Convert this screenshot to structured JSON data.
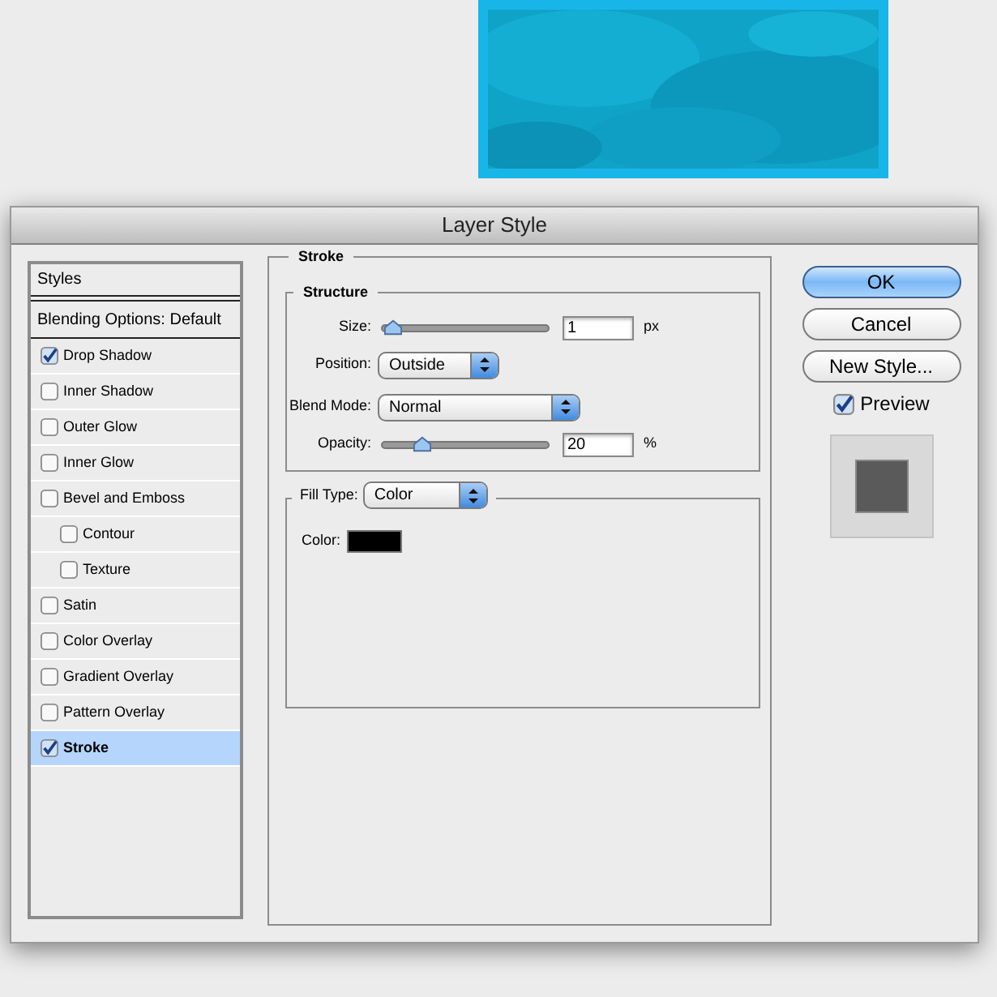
{
  "window": {
    "title": "Layer Style"
  },
  "styles_list": {
    "header": "Styles",
    "blending_options": "Blending Options: Default",
    "items": [
      {
        "label": "Drop Shadow",
        "checked": true,
        "selected": false
      },
      {
        "label": "Inner Shadow",
        "checked": false,
        "selected": false
      },
      {
        "label": "Outer Glow",
        "checked": false,
        "selected": false
      },
      {
        "label": "Inner Glow",
        "checked": false,
        "selected": false
      },
      {
        "label": "Bevel and Emboss",
        "checked": false,
        "selected": false,
        "children": [
          {
            "label": "Contour",
            "checked": false,
            "selected": false
          },
          {
            "label": "Texture",
            "checked": false,
            "selected": false
          }
        ]
      },
      {
        "label": "Satin",
        "checked": false,
        "selected": false
      },
      {
        "label": "Color Overlay",
        "checked": false,
        "selected": false
      },
      {
        "label": "Gradient Overlay",
        "checked": false,
        "selected": false
      },
      {
        "label": "Pattern Overlay",
        "checked": false,
        "selected": false
      },
      {
        "label": "Stroke",
        "checked": true,
        "selected": true
      }
    ]
  },
  "stroke": {
    "title": "Stroke",
    "structure": {
      "title": "Structure",
      "rows": [
        {
          "kind": "slider",
          "label": "Size:",
          "level": 0.01,
          "value": "1",
          "unit": "px"
        },
        {
          "kind": "select",
          "label": "Position:",
          "value": "Outside"
        },
        {
          "kind": "select",
          "label": "Blend Mode:",
          "value": "Normal"
        },
        {
          "kind": "slider",
          "label": "Opacity:",
          "level": 0.2,
          "value": "20",
          "unit": "%"
        }
      ]
    },
    "fill_type": {
      "label": "Fill Type:",
      "value": "Color",
      "color_label": "Color:",
      "color": "#000000"
    }
  },
  "buttons": [
    {
      "label": "OK",
      "default": true
    },
    {
      "label": "Cancel",
      "default": false
    },
    {
      "label": "New Style...",
      "default": false
    }
  ],
  "preview": {
    "label": "Preview",
    "checked": true
  }
}
